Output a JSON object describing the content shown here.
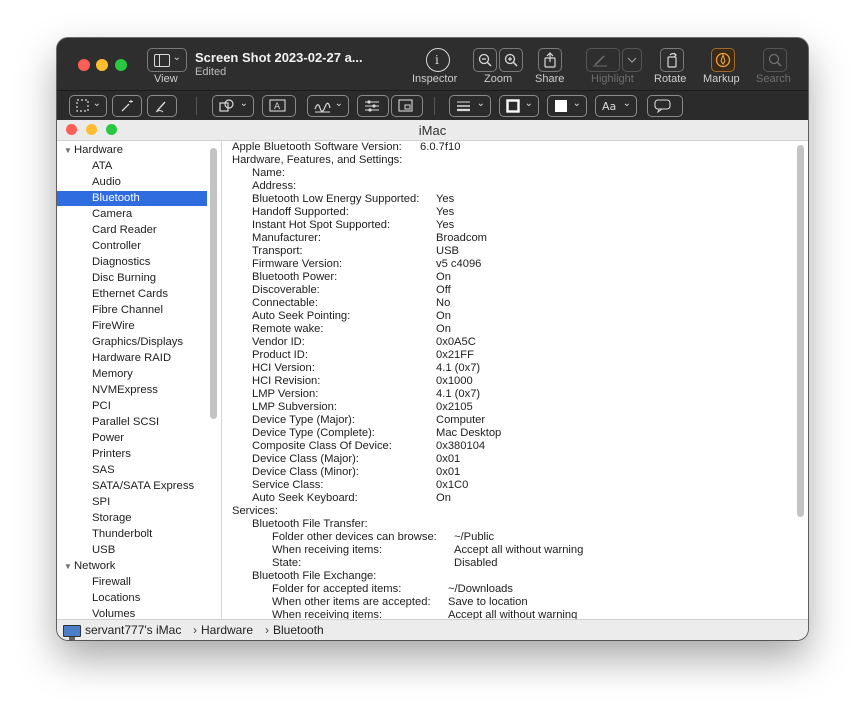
{
  "preview": {
    "title": "Screen Shot 2023-02-27 a...",
    "subtitle": "Edited",
    "labels": {
      "view": "View",
      "inspector": "Inspector",
      "zoom": "Zoom",
      "share": "Share",
      "highlight": "Highlight",
      "rotate": "Rotate",
      "markup": "Markup",
      "search": "Search"
    }
  },
  "inner_window": {
    "title": "iMac"
  },
  "sidebar": {
    "items": [
      {
        "label": "Hardware",
        "group": true
      },
      {
        "label": "ATA"
      },
      {
        "label": "Audio"
      },
      {
        "label": "Bluetooth",
        "selected": true
      },
      {
        "label": "Camera"
      },
      {
        "label": "Card Reader"
      },
      {
        "label": "Controller"
      },
      {
        "label": "Diagnostics"
      },
      {
        "label": "Disc Burning"
      },
      {
        "label": "Ethernet Cards"
      },
      {
        "label": "Fibre Channel"
      },
      {
        "label": "FireWire"
      },
      {
        "label": "Graphics/Displays"
      },
      {
        "label": "Hardware RAID"
      },
      {
        "label": "Memory"
      },
      {
        "label": "NVMExpress"
      },
      {
        "label": "PCI"
      },
      {
        "label": "Parallel SCSI"
      },
      {
        "label": "Power"
      },
      {
        "label": "Printers"
      },
      {
        "label": "SAS"
      },
      {
        "label": "SATA/SATA Express"
      },
      {
        "label": "SPI"
      },
      {
        "label": "Storage"
      },
      {
        "label": "Thunderbolt"
      },
      {
        "label": "USB"
      },
      {
        "label": "Network",
        "group": true
      },
      {
        "label": "Firewall"
      },
      {
        "label": "Locations"
      },
      {
        "label": "Volumes"
      }
    ]
  },
  "content": {
    "rows": [
      {
        "key": "Apple Bluetooth Software Version:",
        "value": "6.0.7f10",
        "indent": 0
      },
      {
        "key": "Hardware, Features, and Settings:",
        "value": "",
        "indent": 0
      },
      {
        "key": "Name:",
        "value": "",
        "indent": 1
      },
      {
        "key": "Address:",
        "value": "",
        "indent": 1
      },
      {
        "key": "Bluetooth Low Energy Supported:",
        "value": "Yes",
        "indent": 1
      },
      {
        "key": "Handoff Supported:",
        "value": "Yes",
        "indent": 1
      },
      {
        "key": "Instant Hot Spot Supported:",
        "value": "Yes",
        "indent": 1
      },
      {
        "key": "Manufacturer:",
        "value": "Broadcom",
        "indent": 1
      },
      {
        "key": "Transport:",
        "value": "USB",
        "indent": 1
      },
      {
        "key": "Firmware Version:",
        "value": "v5 c4096",
        "indent": 1
      },
      {
        "key": "Bluetooth Power:",
        "value": "On",
        "indent": 1
      },
      {
        "key": "Discoverable:",
        "value": "Off",
        "indent": 1
      },
      {
        "key": "Connectable:",
        "value": "No",
        "indent": 1
      },
      {
        "key": "Auto Seek Pointing:",
        "value": "On",
        "indent": 1
      },
      {
        "key": "Remote wake:",
        "value": "On",
        "indent": 1
      },
      {
        "key": "Vendor ID:",
        "value": "0x0A5C",
        "indent": 1
      },
      {
        "key": "Product ID:",
        "value": "0x21FF",
        "indent": 1
      },
      {
        "key": "HCI Version:",
        "value": "4.1 (0x7)",
        "indent": 1
      },
      {
        "key": "HCI Revision:",
        "value": "0x1000",
        "indent": 1
      },
      {
        "key": "LMP Version:",
        "value": "4.1 (0x7)",
        "indent": 1
      },
      {
        "key": "LMP Subversion:",
        "value": "0x2105",
        "indent": 1
      },
      {
        "key": "Device Type (Major):",
        "value": "Computer",
        "indent": 1
      },
      {
        "key": "Device Type (Complete):",
        "value": "Mac Desktop",
        "indent": 1
      },
      {
        "key": "Composite Class Of Device:",
        "value": "0x380104",
        "indent": 1
      },
      {
        "key": "Device Class (Major):",
        "value": "0x01",
        "indent": 1
      },
      {
        "key": "Device Class (Minor):",
        "value": "0x01",
        "indent": 1
      },
      {
        "key": "Service Class:",
        "value": "0x1C0",
        "indent": 1
      },
      {
        "key": "Auto Seek Keyboard:",
        "value": "On",
        "indent": 1
      },
      {
        "key": "Services:",
        "value": "",
        "indent": 0
      },
      {
        "key": "Bluetooth File Transfer:",
        "value": "",
        "indent": 1
      },
      {
        "key": "Folder other devices can browse:",
        "value": "~/Public",
        "indent": 2,
        "col": "a"
      },
      {
        "key": "When receiving items:",
        "value": "Accept all without warning",
        "indent": 2,
        "col": "a"
      },
      {
        "key": "State:",
        "value": "Disabled",
        "indent": 2,
        "col": "a"
      },
      {
        "key": "Bluetooth File Exchange:",
        "value": "",
        "indent": 1
      },
      {
        "key": "Folder for accepted items:",
        "value": "~/Downloads",
        "indent": 2,
        "col": "b"
      },
      {
        "key": "When other items are accepted:",
        "value": "Save to location",
        "indent": 2,
        "col": "b"
      },
      {
        "key": "When receiving items:",
        "value": "Accept all without warning",
        "indent": 2,
        "col": "b"
      }
    ]
  },
  "statusbar": {
    "crumbs": [
      "servant777's iMac",
      "Hardware",
      "Bluetooth"
    ],
    "separator": "›"
  },
  "colors": {
    "selection": "#2f6ce0",
    "markup_accent": "#f0a040"
  }
}
